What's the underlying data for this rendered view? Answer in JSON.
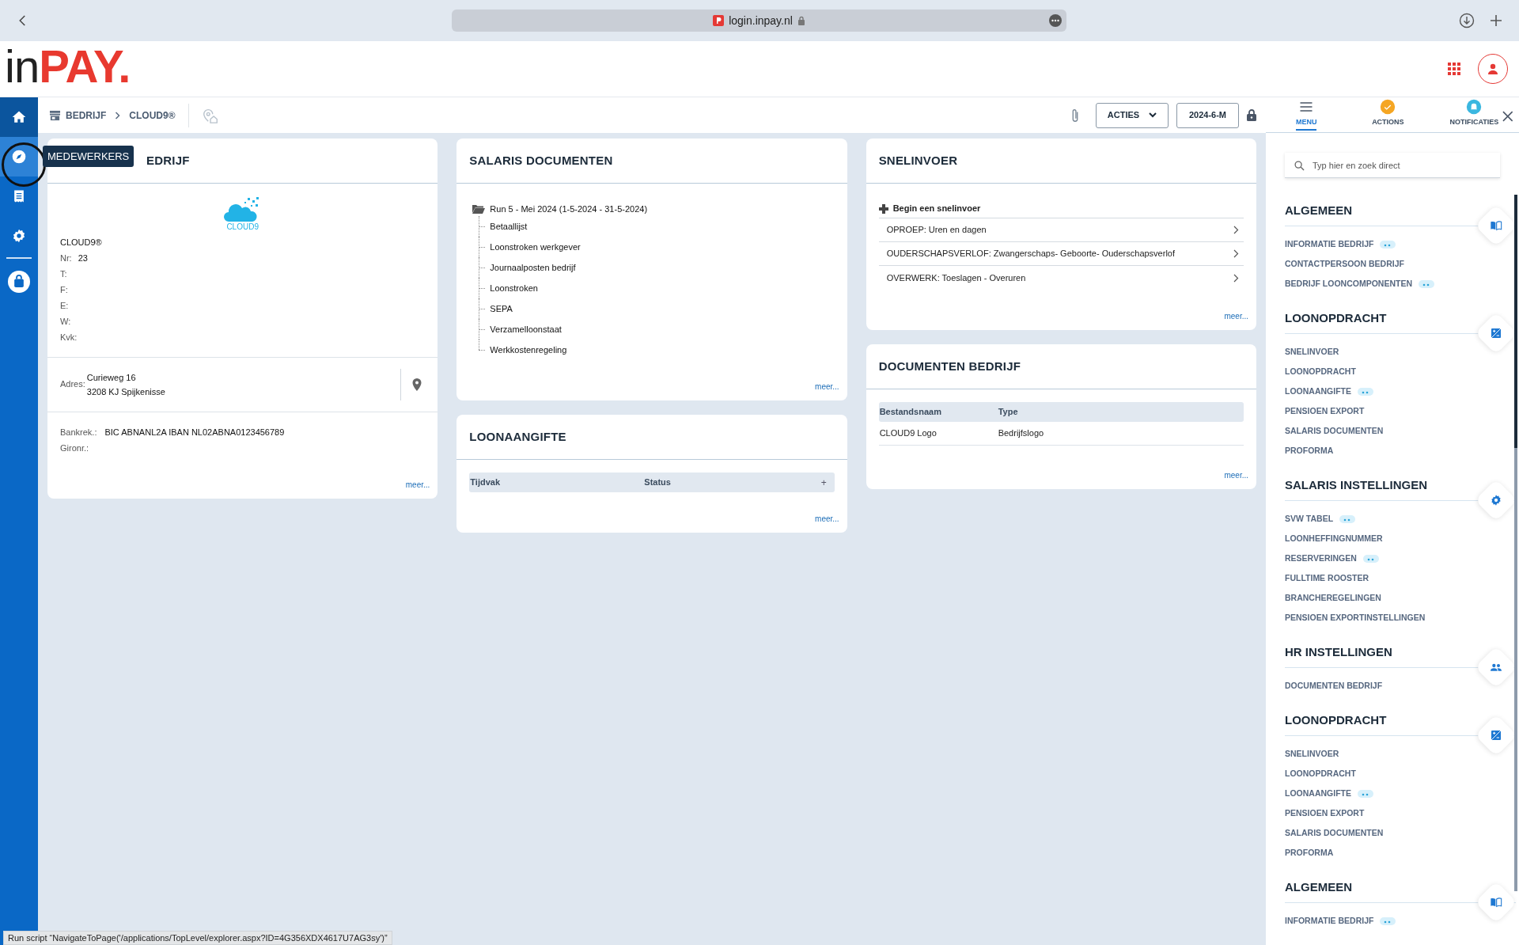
{
  "browser": {
    "url": "login.inpay.nl"
  },
  "header": {
    "logo_parts": [
      "in",
      "PAY."
    ]
  },
  "nav": [
    {
      "kind": "home",
      "selected": true
    },
    {
      "kind": "compass",
      "selected": false,
      "hovered": true
    },
    {
      "kind": "list",
      "selected": false
    },
    {
      "kind": "settings",
      "selected": false
    },
    {
      "kind": "bag",
      "selected": false
    }
  ],
  "tooltip": "MEDEWERKERS",
  "breadcrumb": [
    "BEDRIJF",
    "CLOUD9®"
  ],
  "toolbar": {
    "actions_button": "ACTIES",
    "period_button": "2024-6-M"
  },
  "columns": [
    [
      {
        "kind": "info",
        "title": "EDRIJF",
        "logo_text": "CLOUD9",
        "company": "CLOUD9®",
        "fields": [
          {
            "label": "Nr:",
            "value": "23"
          },
          {
            "label": "T:"
          },
          {
            "label": "F:"
          },
          {
            "label": "E:"
          },
          {
            "label": "W:"
          },
          {
            "label": "Kvk:"
          }
        ],
        "address": {
          "label": "Adres:",
          "lines": [
            "Curieweg 16",
            "3208 KJ Spijkenisse"
          ]
        },
        "bank": [
          {
            "label": "Bankrek.:",
            "value": "BIC ABNANL2A IBAN NL02ABNA0123456789"
          },
          {
            "label": "Gironr.:"
          }
        ],
        "more": "meer..."
      }
    ],
    [
      {
        "kind": "tree",
        "title": "SALARIS DOCUMENTEN",
        "root": "Run 5 - Mei 2024 (1-5-2024 - 31-5-2024)",
        "children": [
          {
            "label": "Betaallijst"
          },
          {
            "label": "Loonstroken werkgever"
          },
          {
            "label": "Journaalposten bedrijf"
          },
          {
            "label": "Loonstroken"
          },
          {
            "label": "SEPA"
          },
          {
            "label": "Verzamelloonstaat"
          },
          {
            "label": "Werkkostenregeling"
          }
        ],
        "more": "meer..."
      },
      {
        "kind": "table",
        "title": "LOONAANGIFTE",
        "columns": [
          "Tijdvak",
          "Status"
        ],
        "add": "+",
        "more": "meer..."
      }
    ],
    [
      {
        "kind": "quick",
        "title": "SNELINVOER",
        "start": "Begin een snelinvoer",
        "items": [
          "OPROEP: Uren en dagen",
          "OUDERSCHAPSVERLOF: Zwangerschaps- Geboorte- Ouderschapsverlof",
          "OVERWERK: Toeslagen - Overuren"
        ],
        "more": "meer..."
      },
      {
        "kind": "table",
        "title": "DOCUMENTEN BEDRIJF",
        "columns": [
          "Bestandsnaam",
          "Type"
        ],
        "rows": [
          [
            "CLOUD9 Logo",
            "Bedrijfslogo"
          ]
        ],
        "more": "meer..."
      }
    ]
  ],
  "panel": {
    "tabs": [
      {
        "kind": "menu",
        "label": "MENU",
        "selected": true
      },
      {
        "kind": "actions",
        "label": "ACTIONS",
        "selected": false
      },
      {
        "kind": "notifications",
        "label": "NOTIFICATIES",
        "selected": false
      }
    ],
    "search": {
      "placeholder": "Typ hier en zoek direct"
    },
    "sections": [
      {
        "title": "ALGEMEEN",
        "kind": "book",
        "items": [
          {
            "label": "INFORMATIE BEDRIJF",
            "has_more": true
          },
          {
            "label": "CONTACTPERSOON BEDRIJF",
            "has_more": false
          },
          {
            "label": "BEDRIJF LOONCOMPONENTEN",
            "has_more": true
          }
        ]
      },
      {
        "title": "LOONOPDRACHT",
        "kind": "exposure",
        "items": [
          {
            "label": "SNELINVOER",
            "has_more": false
          },
          {
            "label": "LOONOPDRACHT",
            "has_more": false
          },
          {
            "label": "LOONAANGIFTE",
            "has_more": true
          },
          {
            "label": "PENSIOEN EXPORT",
            "has_more": false
          },
          {
            "label": "SALARIS DOCUMENTEN",
            "has_more": false
          },
          {
            "label": "PROFORMA",
            "has_more": false
          }
        ]
      },
      {
        "title": "SALARIS INSTELLINGEN",
        "kind": "gear",
        "items": [
          {
            "label": "SVW TABEL",
            "has_more": true
          },
          {
            "label": "LOONHEFFINGNUMMER",
            "has_more": false
          },
          {
            "label": "RESERVERINGEN",
            "has_more": true
          },
          {
            "label": "FULLTIME ROOSTER",
            "has_more": false
          },
          {
            "label": "BRANCHEREGELINGEN",
            "has_more": false
          },
          {
            "label": "PENSIOEN EXPORTINSTELLINGEN",
            "has_more": false
          }
        ]
      },
      {
        "title": "HR INSTELLINGEN",
        "kind": "people",
        "items": [
          {
            "label": "DOCUMENTEN BEDRIJF",
            "has_more": false
          }
        ]
      },
      {
        "title": "LOONOPDRACHT",
        "kind": "exposure",
        "items": [
          {
            "label": "SNELINVOER",
            "has_more": false
          },
          {
            "label": "LOONOPDRACHT",
            "has_more": false
          },
          {
            "label": "LOONAANGIFTE",
            "has_more": true
          },
          {
            "label": "PENSIOEN EXPORT",
            "has_more": false
          },
          {
            "label": "SALARIS DOCUMENTEN",
            "has_more": false
          },
          {
            "label": "PROFORMA",
            "has_more": false
          }
        ]
      },
      {
        "title": "ALGEMEEN",
        "kind": "book",
        "items": [
          {
            "label": "INFORMATIE BEDRIJF",
            "has_more": true
          }
        ]
      }
    ]
  },
  "status_text": "Run script “NavigateToPage('/applications/TopLevel/explorer.aspx?ID=4G356XDX4617U7AG3sy')”"
}
